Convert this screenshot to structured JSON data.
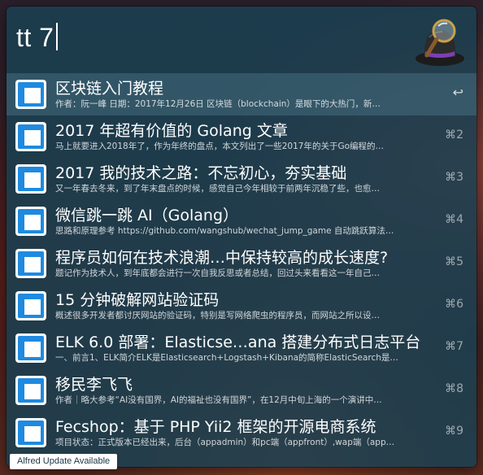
{
  "search": {
    "query": "tt 7"
  },
  "colors": {
    "window_bg": "#1a4052",
    "selected_row": "#466e80",
    "icon_blue": "#1e8ae0"
  },
  "icons": {
    "app": "alfred-hat-icon",
    "result": "document-icon"
  },
  "results": [
    {
      "title": "区块链入门教程",
      "subtitle": "作者：阮一峰 日期：2017年12月26日    区块链（blockchain）是眼下的大热门，新…",
      "shortcut": "↩"
    },
    {
      "title": "2017 年超有价值的 Golang 文章",
      "subtitle": "马上就要进入2018年了，作为年终的盘点，本文列出了一些2017年的关于Go编程的…",
      "shortcut": "⌘2"
    },
    {
      "title": "2017 我的技术之路：不忘初心，夯实基础",
      "subtitle": "又一年春去冬来，到了年末盘点的时候，感觉自己今年相较于前两年沉稳了些，也愈…",
      "shortcut": "⌘3"
    },
    {
      "title": "微信跳一跳 AI（Golang）",
      "subtitle": "思路和原理参考 https://github.com/wangshub/wechat_jump_game 自动跳跃算法…",
      "shortcut": "⌘4"
    },
    {
      "title": "程序员如何在技术浪潮…中保持较高的成长速度?",
      "subtitle": "题记作为技术人，到年底都会进行一次自我反思或者总结，回过头来看看这一年自己…",
      "shortcut": "⌘5"
    },
    {
      "title": "15 分钟破解网站验证码",
      "subtitle": "概述很多开发者都讨厌网站的验证码，特别是写网络爬虫的程序员，而网站之所以设…",
      "shortcut": "⌘6"
    },
    {
      "title": "ELK 6.0 部署：Elasticse…ana 搭建分布式日志平台",
      "subtitle": "一、前言1、ELK简介ELK是Elasticsearch+Logstash+Kibana的简称ElasticSearch是…",
      "shortcut": "⌘7"
    },
    {
      "title": "移民李飞飞",
      "subtitle": "作者｜略大参考“AI没有国界，AI的福祉也没有国界”，在12月中旬上海的一个演讲中…",
      "shortcut": "⌘8"
    },
    {
      "title": "Fecshop：基于 PHP Yii2 框架的开源电商系统",
      "subtitle": "项目状态：正式版本已经出来，后台（appadmin）和pc端（appfront）,wap端（app…",
      "shortcut": "⌘9"
    }
  ],
  "footer": {
    "update_notice": "Alfred Update Available"
  }
}
